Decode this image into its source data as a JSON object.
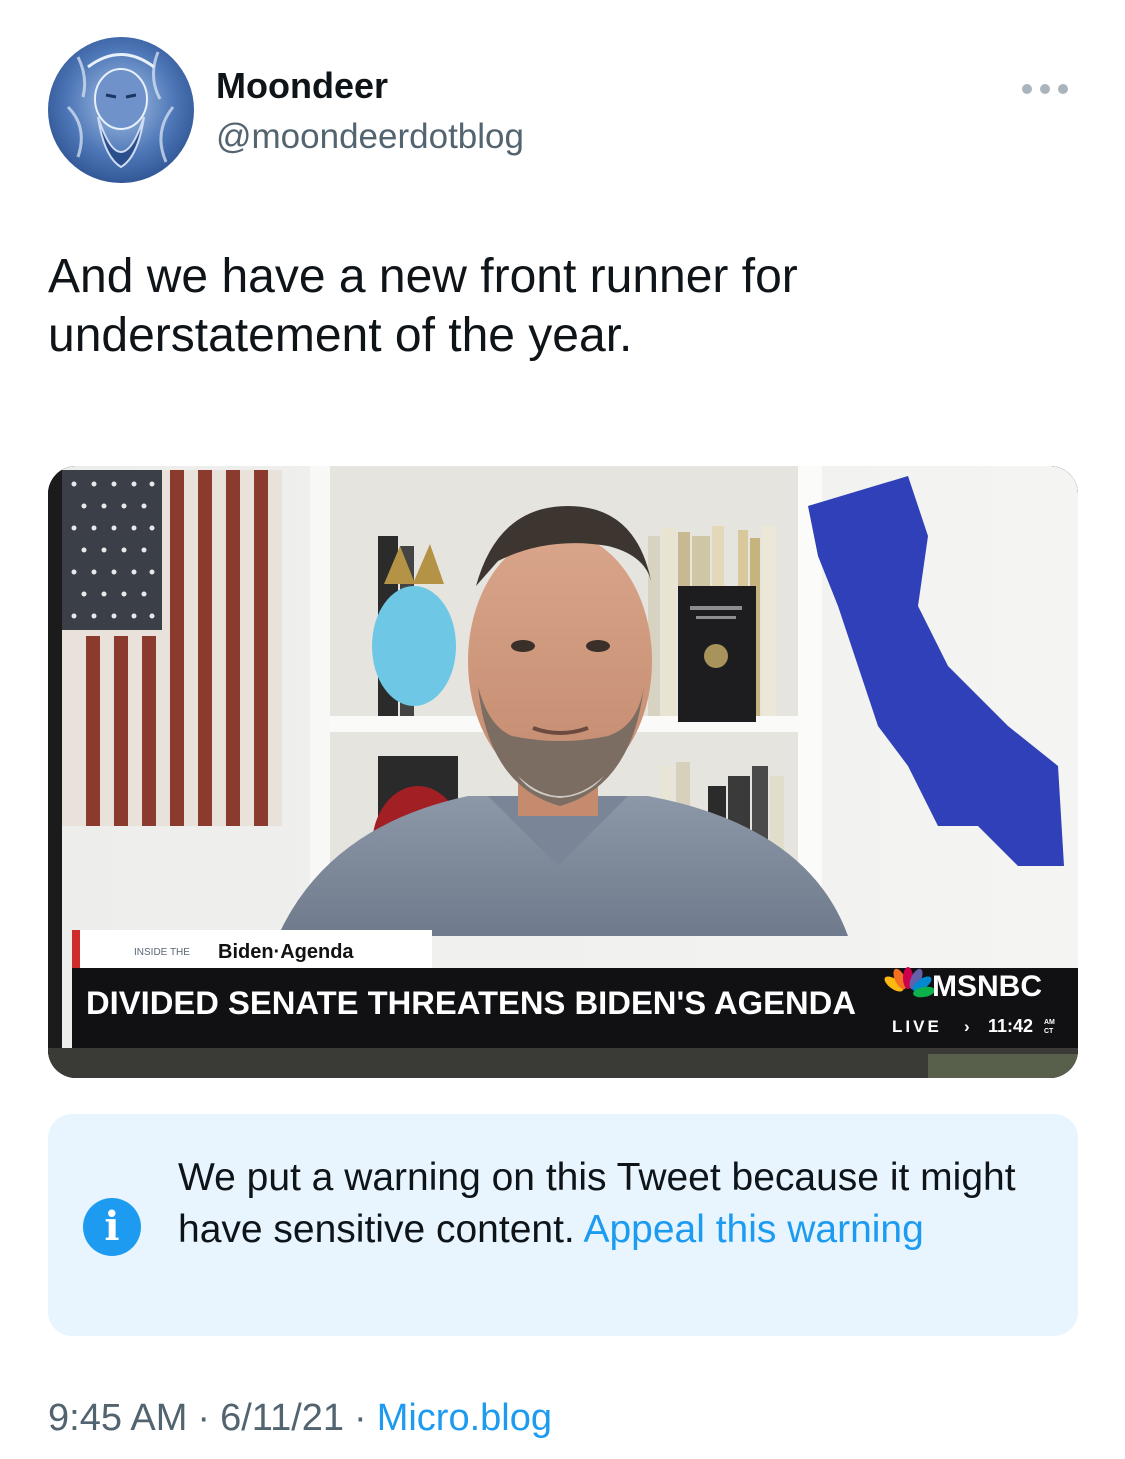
{
  "author": {
    "name": "Moondeer",
    "handle": "@moondeerdotblog"
  },
  "tweet": {
    "line1": "And we have a new front runner for",
    "line2": "understatement of the year."
  },
  "media": {
    "inside_prefix": "INSIDE THE",
    "show_name": "Biden·Agenda",
    "headline": "DIVIDED SENATE THREATENS BIDEN'S AGENDA",
    "network": "MSNBC",
    "live": "LIVE",
    "live_chevron": "›",
    "clock": "11:42",
    "clock_am": "AM",
    "clock_tz": "CT",
    "accent_color": "#d02c2c",
    "map_color": "#2f40b8"
  },
  "warning": {
    "text": "We put a warning on this Tweet because it might have sensitive content.",
    "link": "Appeal this warning"
  },
  "meta": {
    "time": "9:45 AM",
    "date": "6/11/21",
    "separator": "·",
    "source": "Micro.blog"
  }
}
